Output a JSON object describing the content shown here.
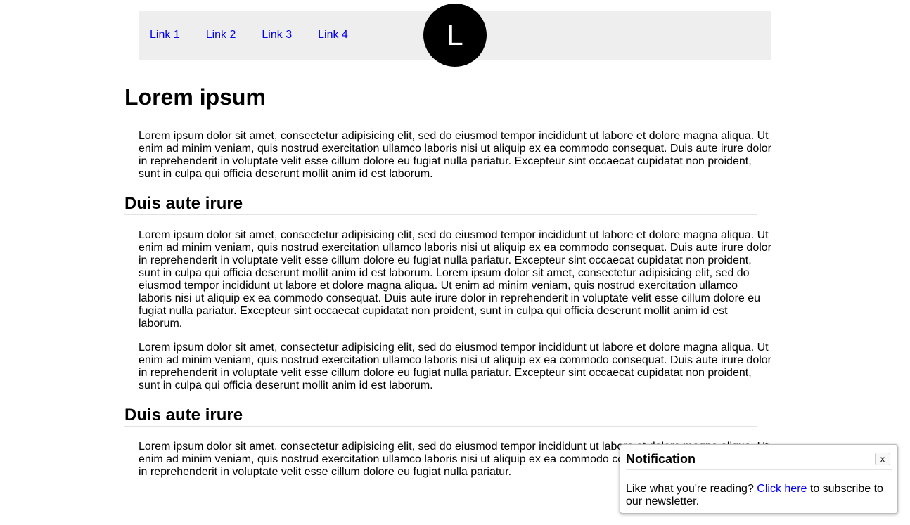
{
  "nav": {
    "links": [
      "Link 1",
      "Link 2",
      "Link 3",
      "Link 4"
    ],
    "logo_letter": "L"
  },
  "article": {
    "title": "Lorem ipsum",
    "section1_paragraph": "Lorem ipsum dolor sit amet, consectetur adipisicing elit, sed do eiusmod tempor incididunt ut labore et dolore magna aliqua. Ut enim ad minim veniam, quis nostrud exercitation ullamco laboris nisi ut aliquip ex ea commodo consequat. Duis aute irure dolor in reprehenderit in voluptate velit esse cillum dolore eu fugiat nulla pariatur. Excepteur sint occaecat cupidatat non proident, sunt in culpa qui officia deserunt mollit anim id est laborum.",
    "section2_heading": "Duis aute irure",
    "section2_paragraph1": "Lorem ipsum dolor sit amet, consectetur adipisicing elit, sed do eiusmod tempor incididunt ut labore et dolore magna aliqua. Ut enim ad minim veniam, quis nostrud exercitation ullamco laboris nisi ut aliquip ex ea commodo consequat. Duis aute irure dolor in reprehenderit in voluptate velit esse cillum dolore eu fugiat nulla pariatur. Excepteur sint occaecat cupidatat non proident, sunt in culpa qui officia deserunt mollit anim id est laborum. Lorem ipsum dolor sit amet, consectetur adipisicing elit, sed do eiusmod tempor incididunt ut labore et dolore magna aliqua. Ut enim ad minim veniam, quis nostrud exercitation ullamco laboris nisi ut aliquip ex ea commodo consequat. Duis aute irure dolor in reprehenderit in voluptate velit esse cillum dolore eu fugiat nulla pariatur. Excepteur sint occaecat cupidatat non proident, sunt in culpa qui officia deserunt mollit anim id est laborum.",
    "section2_paragraph2": "Lorem ipsum dolor sit amet, consectetur adipisicing elit, sed do eiusmod tempor incididunt ut labore et dolore magna aliqua. Ut enim ad minim veniam, quis nostrud exercitation ullamco laboris nisi ut aliquip ex ea commodo consequat. Duis aute irure dolor in reprehenderit in voluptate velit esse cillum dolore eu fugiat nulla pariatur. Excepteur sint occaecat cupidatat non proident, sunt in culpa qui officia deserunt mollit anim id est laborum.",
    "section3_heading": "Duis aute irure",
    "section3_paragraph": "Lorem ipsum dolor sit amet, consectetur adipisicing elit, sed do eiusmod tempor incididunt ut labore et dolore magna aliqua. Ut enim ad minim veniam, quis nostrud exercitation ullamco laboris nisi ut aliquip ex ea commodo consequat. Duis aute irure dolor in reprehenderit in voluptate velit esse cillum dolore eu fugiat nulla pariatur."
  },
  "notification": {
    "title": "Notification",
    "close_label": "x",
    "body_before": "Like what you're reading? ",
    "link_text": "Click here",
    "body_after": " to subscribe to our newsletter."
  },
  "colors": {
    "link": "#0000ee",
    "nav_background": "#eeeeee",
    "logo_background": "#000000"
  }
}
